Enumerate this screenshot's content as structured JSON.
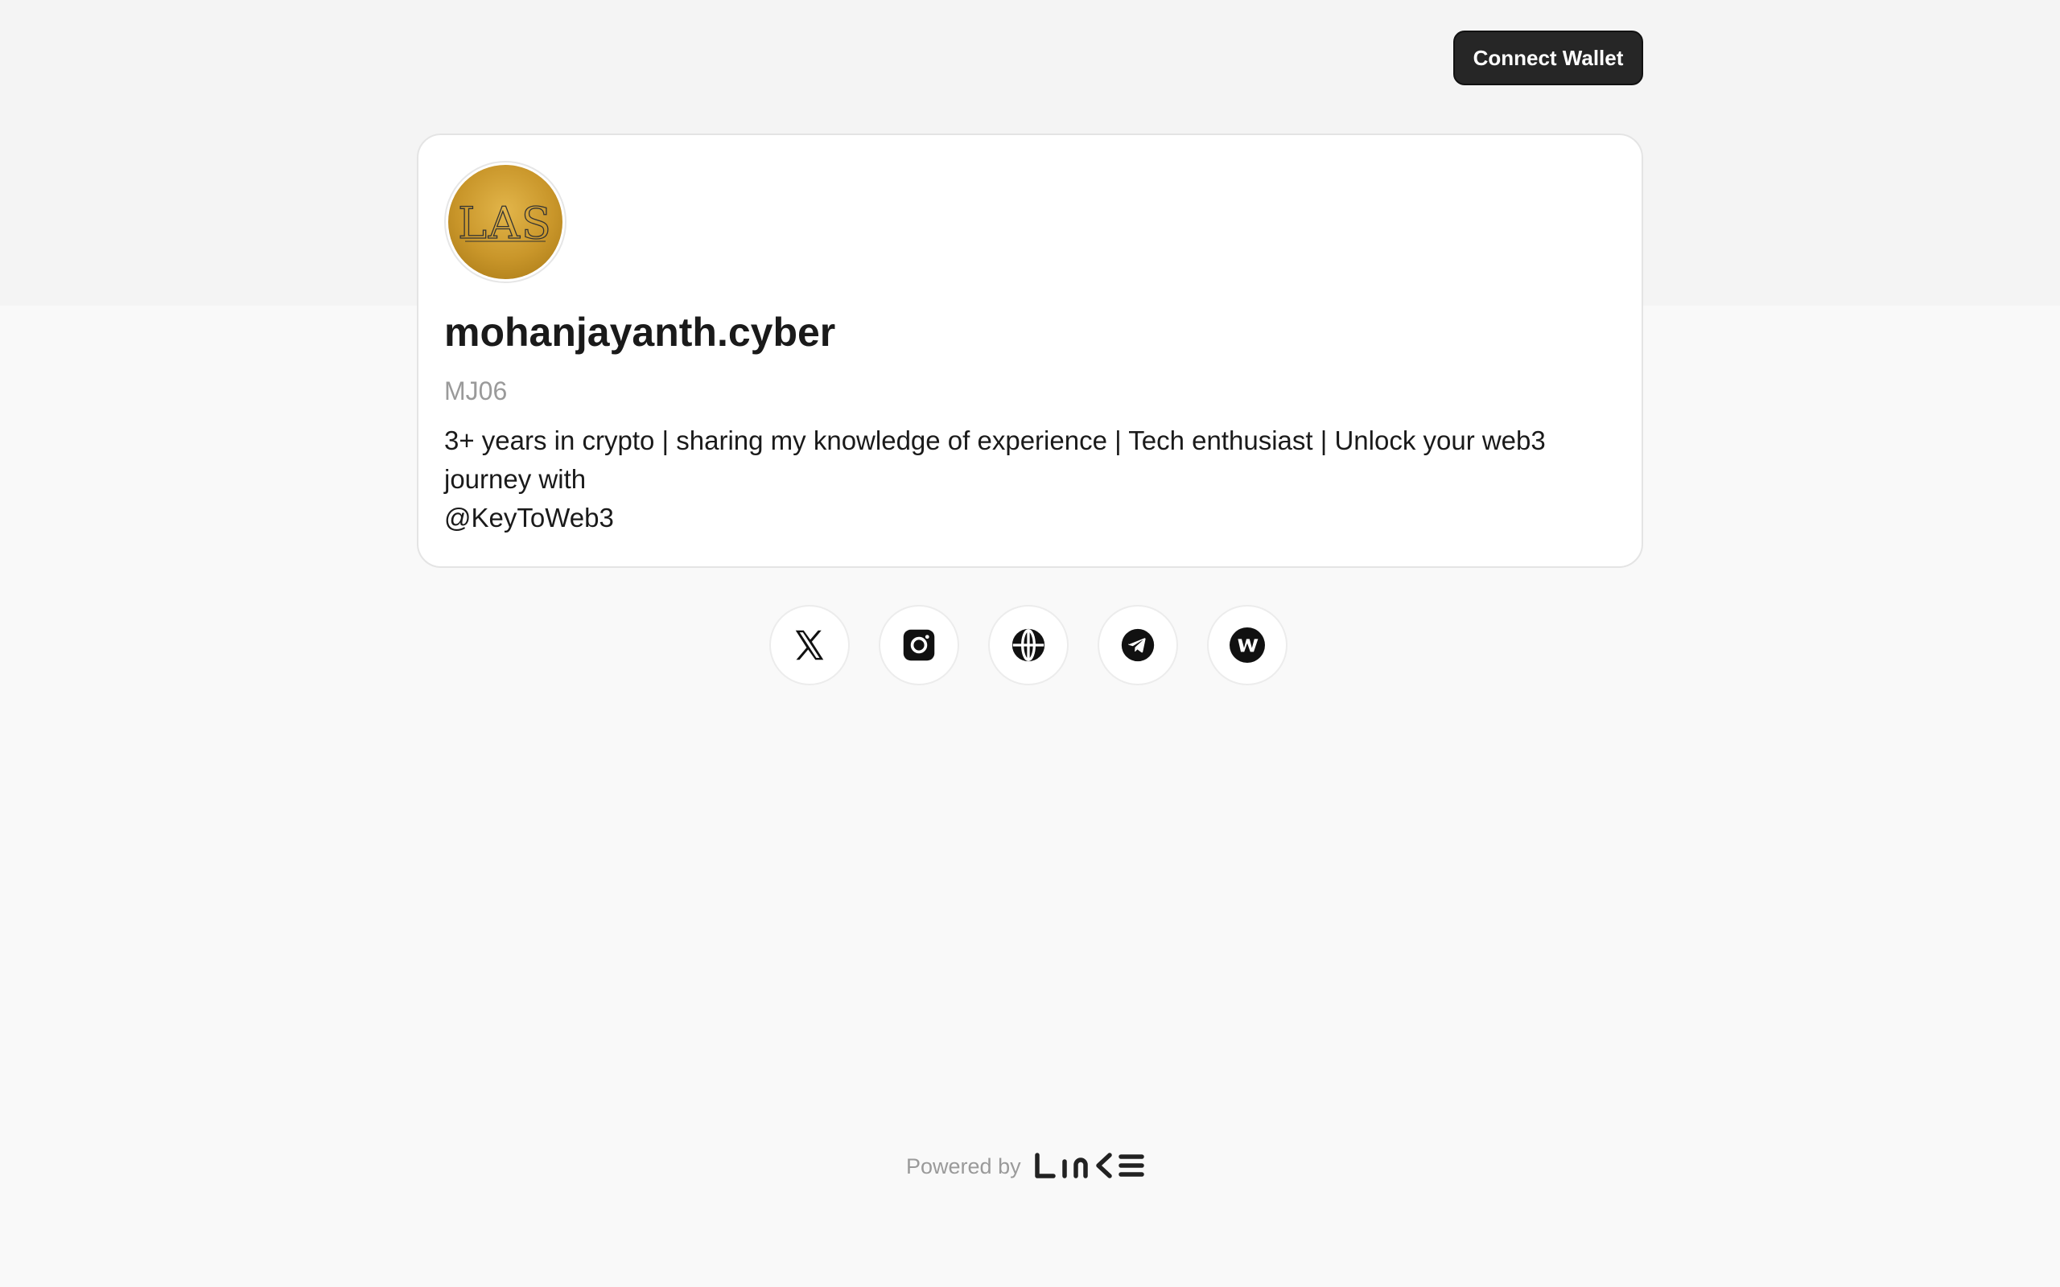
{
  "header": {
    "connect_wallet_label": "Connect Wallet"
  },
  "profile": {
    "name": "mohanjayanth.cyber",
    "handle": "MJ06",
    "bio_lines": [
      "3+ years in crypto | sharing my knowledge of experience | Tech enthusiast | Unlock your web3",
      "journey with",
      "@KeyToWeb3"
    ],
    "avatar_text": "LAS"
  },
  "socials": [
    {
      "name": "x-icon"
    },
    {
      "name": "instagram-icon"
    },
    {
      "name": "globe-icon"
    },
    {
      "name": "telegram-icon"
    },
    {
      "name": "warpcast-icon"
    }
  ],
  "footer": {
    "powered_by": "Powered by",
    "brand": "LINKE"
  },
  "colors": {
    "avatar_gold": "#c9962a",
    "button_dark": "#262626"
  }
}
